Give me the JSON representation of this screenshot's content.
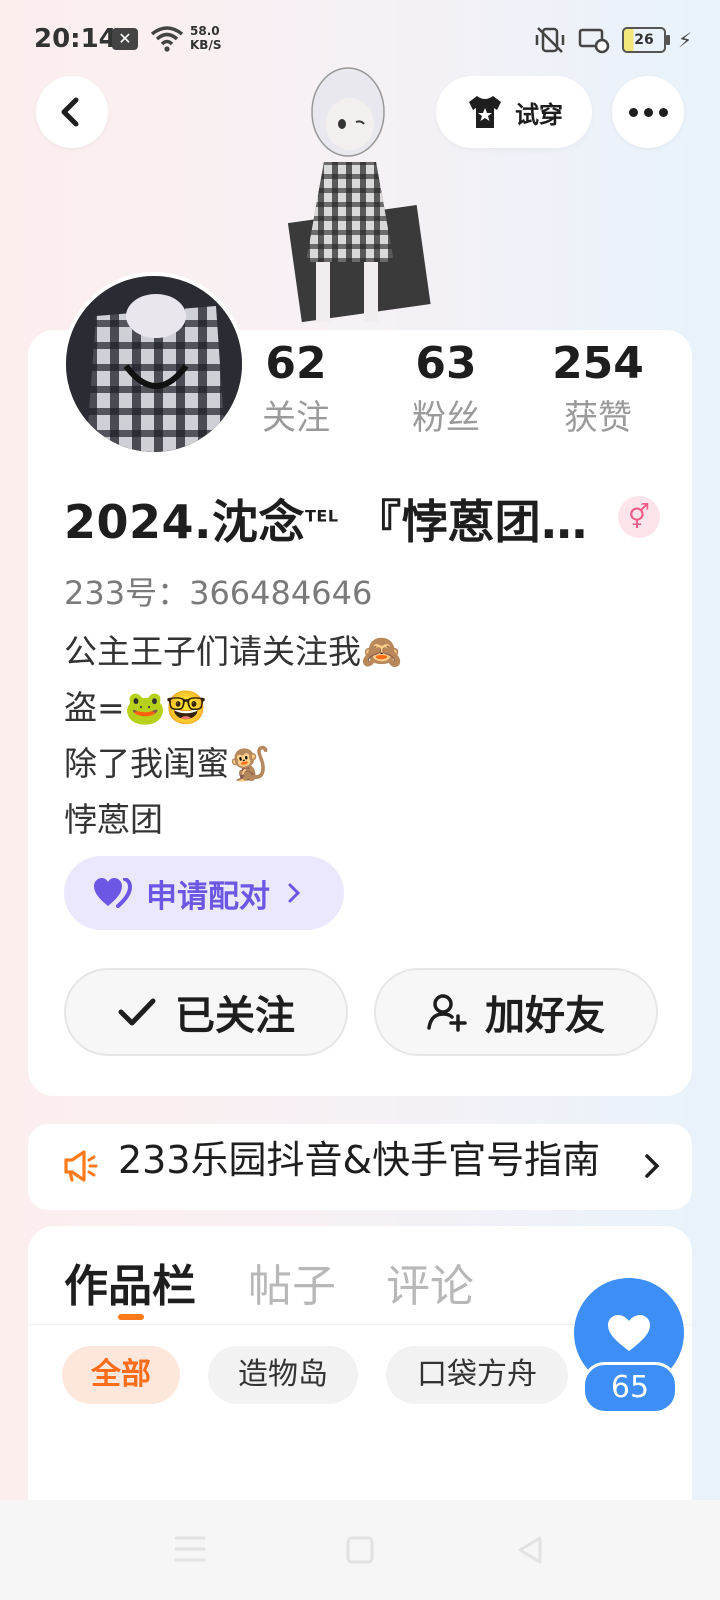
{
  "status_bar": {
    "time": "20:14",
    "net_speed_value": "58.0",
    "net_speed_unit": "KB/S",
    "battery": "26"
  },
  "header": {
    "tryon_label": "试穿"
  },
  "profile": {
    "stats": [
      {
        "value": "62",
        "label": "关注"
      },
      {
        "value": "63",
        "label": "粉丝"
      },
      {
        "value": "254",
        "label": "获赞"
      }
    ],
    "name": "2024.沈念",
    "name_sup": "TEL",
    "name_tail": " 『悖蒽团…",
    "gender_symbol": "⚥",
    "id_text": "233号：366484646",
    "bio_lines": [
      "公主王子们请关注我🙈",
      "盗=🐸🤓",
      "除了我闺蜜🐒",
      "悖蒽团"
    ],
    "pair_label": "申请配对",
    "follow_label": "已关注",
    "add_friend_label": "加好友"
  },
  "notice": {
    "text": "233乐园抖音&快手官号指南"
  },
  "works": {
    "tabs": [
      "作品栏",
      "帖子",
      "评论"
    ],
    "filters": [
      "全部",
      "造物岛",
      "口袋方舟"
    ]
  },
  "like_count": "65",
  "colors": {
    "accent_orange": "#ff7a1a",
    "like_blue": "#3d8ef6",
    "pair_purple": "#6b57e3",
    "gender_pink": "#ee5b86"
  },
  "icons": [
    "back-icon",
    "tshirt-icon",
    "more-icon",
    "heart-icon",
    "check-icon",
    "add-user-icon",
    "megaphone-icon",
    "chevron-right-icon"
  ]
}
